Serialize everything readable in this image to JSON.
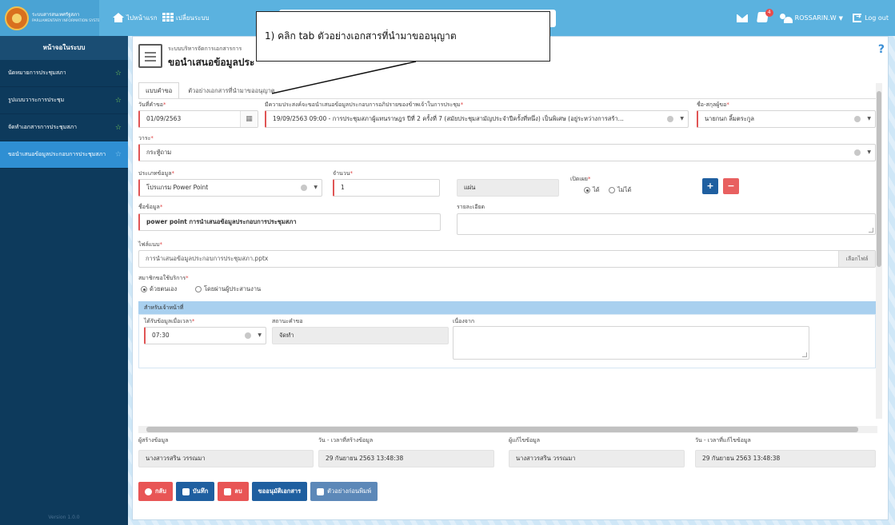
{
  "header": {
    "logo_line1": "ระบบสารสนเทศรัฐสภา",
    "logo_line2": "PARLIAMENTARY INFORMATION SYSTEM",
    "home_label": "ไปหน้าแรก",
    "switch_label": "เปลี่ยนระบบ",
    "notification_count": "4",
    "user_name": "ROSSARIN.W",
    "logout_label": "Log out"
  },
  "sidebar": {
    "title": "หน้าจอในระบบ",
    "items": [
      {
        "label": "นัดหมายการประชุมสภา"
      },
      {
        "label": "รูปแบบวาระการประชุม"
      },
      {
        "label": "จัดทำเอกสารการประชุมสภา"
      },
      {
        "label": "ขอนำเสนอข้อมูลประกอบการประชุมสภา"
      }
    ],
    "version": "Version 1.0.0"
  },
  "page": {
    "subtitle": "ระบบบริหารจัดการเอกสารการ",
    "title": "ขอนำเสนอข้อมูลประ",
    "help": "?"
  },
  "callout": {
    "text": "1) คลิก tab ตัวอย่างเอกสารที่นำมาขออนุญาต"
  },
  "tabs": [
    {
      "label": "แบบคำขอ",
      "active": true
    },
    {
      "label": "ตัวอย่างเอกสารที่นำมาขออนุญาต",
      "active": false
    }
  ],
  "form": {
    "request_date_label": "วันที่คำขอ",
    "request_date": "01/09/2563",
    "purpose_label": "มีความประสงค์จะขอนำเสนอข้อมูลประกอบการอภิปรายของข้าพเจ้าในการประชุม",
    "purpose_value": "19/09/2563 09:00 - การประชุมสภาผู้แทนราษฎร ปีที่ 2 ครั้งที่ 7 (สมัยประชุมสามัญประจำปีครั้งที่หนึ่ง) เป็นพิเศษ (อยู่ระหว่างการสร้า...",
    "name_label": "ชื่อ-สกุลผู้ขอ",
    "name_value": "นายกนก ลิ้มตระกูล",
    "agenda_label": "วาระ",
    "agenda_value": "กระทู้ถาม",
    "data_type_label": "ประเภทข้อมูล",
    "data_type_value": "โปรแกรม Power Point",
    "quantity_label": "จำนวน",
    "quantity_value": "1",
    "unit_value": "แผ่น",
    "disclose_label": "เปิดเผย",
    "disclose_yes": "ได้",
    "disclose_no": "ไม่ได้",
    "data_name_label": "ชื่อข้อมูล",
    "data_name_value": "power point การนำเสนอข้อมูลประกอบการประชุมสภา",
    "detail_label": "รายละเอียด",
    "attachment_label": "ไฟล์แนบ",
    "attachment_value": "การนำเสนอข้อมูลประกอบการประชุมสภา.pptx",
    "browse_label": "เลือกไฟล์",
    "service_label": "สมาชิกขอใช้บริการ",
    "service_self": "ด้วยตนเอง",
    "service_coord": "โดยผ่านผู้ประสานงาน",
    "officer_section": "สำหรับเจ้าหน้าที่",
    "received_label": "ได้รับข้อมูลเมื่อเวลา",
    "received_value": "07:30",
    "status_label": "สถานะคำขอ",
    "status_value": "จัดทำ",
    "reason_label": "เนื่องจาก"
  },
  "audit": {
    "created_by_label": "ผู้สร้างข้อมูล",
    "created_by": "นางสาวรสริน วรรณมา",
    "created_at_label": "วัน - เวลาที่สร้างข้อมูล",
    "created_at": "29 กันยายน 2563 13:48:38",
    "edited_by_label": "ผู้แก้ไขข้อมูล",
    "edited_by": "นางสาวรสริน วรรณมา",
    "edited_at_label": "วัน - เวลาที่แก้ไขข้อมูล",
    "edited_at": "29 กันยายน 2563 13:48:38"
  },
  "buttons": {
    "back": "กลับ",
    "save": "บันทึก",
    "delete": "ลบ",
    "request_approval": "ขออนุมัติเอกสาร",
    "print_preview": "ตัวอย่างก่อนพิมพ์"
  },
  "colors": {
    "topbar": "#5bb2df",
    "sidebar": "#0d3a5c",
    "sidebar_active": "#2f8fd3",
    "required": "#e05555",
    "primary": "#1f5fa0",
    "danger": "#e85555"
  }
}
